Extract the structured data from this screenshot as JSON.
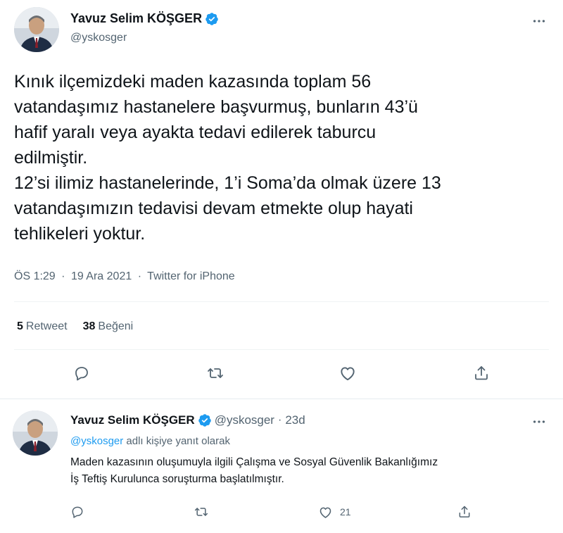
{
  "main_tweet": {
    "author_name": "Yavuz Selim KÖŞGER",
    "author_handle": "@yskosger",
    "text": "Kınık ilçemizdeki maden kazasında toplam 56\nvatandaşımız hastanelere başvurmuş, bunların 43’ü\nhafif yaralı veya ayakta tedavi edilerek taburcu\nedilmiştir.\n12’si ilimiz hastanelerinde, 1’i Soma’da olmak üzere 13\nvatandaşımızın tedavisi devam etmekte olup hayati\ntehlikeleri yoktur.",
    "time": "ÖS 1:29",
    "date": "19 Ara 2021",
    "source": "Twitter for iPhone",
    "separator": "·",
    "retweet_count": "5",
    "retweet_label": "Retweet",
    "like_count": "38",
    "like_label": "Beğeni"
  },
  "reply_tweet": {
    "author_name": "Yavuz Selim KÖŞGER",
    "author_handle": "@yskosger",
    "separator": "·",
    "time": "23d",
    "replying_mention": "@yskosger",
    "replying_suffix": " adlı kişiye yanıt olarak",
    "text": "Maden kazasının oluşumuyla ilgili Çalışma ve Sosyal Güvenlik Bakanlığımız\nİş Teftiş Kurulunca soruşturma başlatılmıştır.",
    "like_count": "21"
  },
  "icons": {
    "verified": "verified-badge-icon",
    "more": "more-horizontal-icon",
    "reply": "reply-bubble-icon",
    "retweet": "retweet-icon",
    "like": "heart-icon",
    "share": "share-icon"
  },
  "colors": {
    "verified": "#1d9bf0",
    "mention": "#1d9bf0",
    "secondary_text": "#536471",
    "divider": "#eff3f4"
  }
}
